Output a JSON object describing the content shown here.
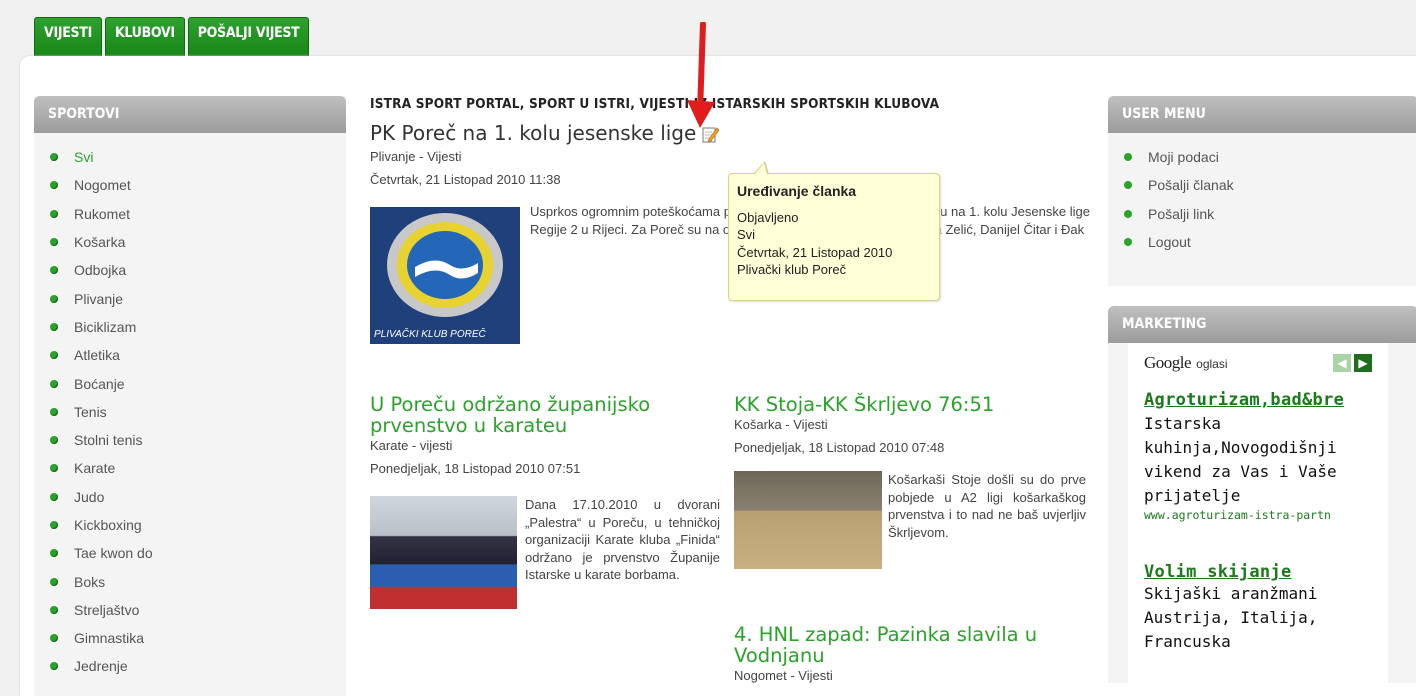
{
  "tabs": [
    "VIJESTI",
    "KLUBOVI",
    "POŠALJI VIJEST"
  ],
  "sidebar": {
    "title": "SPORTOVI",
    "items": [
      "Svi",
      "Nogomet",
      "Rukomet",
      "Košarka",
      "Odbojka",
      "Plivanje",
      "Biciklizam",
      "Atletika",
      "Boćanje",
      "Tenis",
      "Stolni tenis",
      "Karate",
      "Judo",
      "Kickboxing",
      "Tae kwon do",
      "Boks",
      "Streljaštvo",
      "Gimnastika",
      "Jedrenje"
    ]
  },
  "main": {
    "site_heading": "ISTRA SPORT PORTAL, SPORT U ISTRI, VIJESTI IZ ISTARSKIH SPORTSKIH KLUBOVA",
    "featured": {
      "title": "PK Poreč na 1. kolu jesenske lige",
      "category": "Plivanje - Vijesti",
      "date": "Četvrtak, 21 Listopad 2010 11:38",
      "body": "Usprkos ogromnim poteškoćama plivači PK Poreč nastupili su i plivali su na 1. kolu Jesenske lige Regije 2 u Rijeci. Za Poreč su na ovoj kvalifikaciji nastupili su Filip i Noa Zelić, Danijel Čitar i Đak",
      "logo_text": "PLIVAČKI KLUB POREČ"
    },
    "tooltip": {
      "title": "Uređivanje članka",
      "lines": [
        "Objavljeno",
        "Svi",
        "Četvrtak, 21 Listopad 2010",
        "Plivački klub Poreč"
      ]
    },
    "article2": {
      "title": "U Poreču održano županijsko prvenstvo u karateu",
      "category": "Karate - vijesti",
      "date": "Ponedjeljak, 18 Listopad 2010 07:51",
      "body": "Dana 17.10.2010 u dvorani „Palestra“ u Poreču, u tehničkoj organizaciji Karate kluba „Finida“ održano je prvenstvo Županije Istarske u karate borbama."
    },
    "article3": {
      "title": "KK Stoja-KK Škrljevo 76:51",
      "category": "Košarka - Vijesti",
      "date": "Ponedjeljak, 18 Listopad 2010 07:48",
      "body": "Košarkaši Stoje došli su do prve pobjede u A2 ligi košarkaškog prvenstva i to nad ne baš uvjerljiv Škrljevom."
    },
    "article4": {
      "title": "4. HNL zapad: Pazinka slavila u Vodnjanu",
      "category": "Nogomet - Vijesti"
    }
  },
  "user_menu": {
    "title": "USER MENU",
    "items": [
      "Moji podaci",
      "Pošalji članak",
      "Pošalji link",
      "Logout"
    ]
  },
  "marketing": {
    "title": "MARKETING",
    "google": "Google",
    "oglasi": "oglasi",
    "ads": [
      {
        "title": "Agroturizam,bad&bre",
        "text": "Istarska kuhinja,Novogodišnji vikend za Vas i Vaše prijatelje",
        "url": "www.agroturizam-istra-partn"
      },
      {
        "title": "Volim skijanje",
        "text": "Skijaški aranžmani Austrija, Italija, Francuska",
        "url": ""
      }
    ]
  },
  "colors": {
    "accent": "#2aa32a",
    "tab": "#178617",
    "tooltip_bg": "#ffffd8",
    "arrow": "#e01c1c"
  }
}
